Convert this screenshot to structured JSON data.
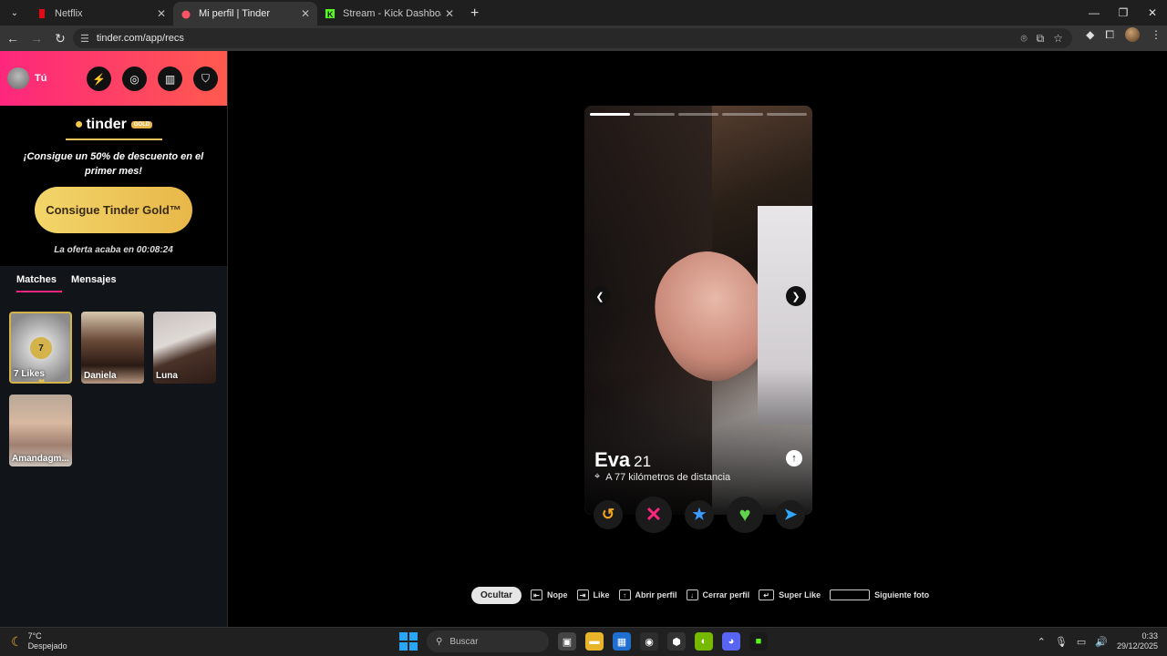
{
  "browser": {
    "tabs": [
      {
        "title": "Netflix",
        "favicon_color": "#e50914",
        "active": false
      },
      {
        "title": "Mi perfil | Tinder",
        "favicon_color": "#fd5564",
        "active": true
      },
      {
        "title": "Stream - Kick Dashboard",
        "favicon_color": "#53fc18",
        "active": false
      }
    ],
    "url": "tinder.com/app/recs"
  },
  "sidebar": {
    "user_label": "Tú",
    "gold_logo": "tinder",
    "gold_badge": "GOLD",
    "promo_text": "¡Consigue un 50% de descuento en el primer mes!",
    "gold_button": "Consigue Tinder Gold™",
    "offer_timer": "La oferta acaba en 00:08:24",
    "tabs": [
      "Matches",
      "Mensajes"
    ],
    "likes": {
      "count": "7",
      "label": "7 Likes"
    },
    "matches": [
      {
        "name": "Daniela"
      },
      {
        "name": "Luna"
      },
      {
        "name": "Amandagm..."
      }
    ]
  },
  "profile": {
    "name": "Eva",
    "age": "21",
    "distance": "A 77 kilómetros de distancia",
    "photo_count": 5,
    "current_photo": 1
  },
  "shortcuts": {
    "hide": "Ocultar",
    "nope": "Nope",
    "like": "Like",
    "open": "Abrir perfil",
    "close": "Cerrar perfil",
    "superlike": "Super Like",
    "next_photo": "Siguiente foto"
  },
  "taskbar": {
    "temp": "7°C",
    "weather": "Despejado",
    "search_placeholder": "Buscar",
    "time": "0:33",
    "date": "29/12/2025"
  }
}
